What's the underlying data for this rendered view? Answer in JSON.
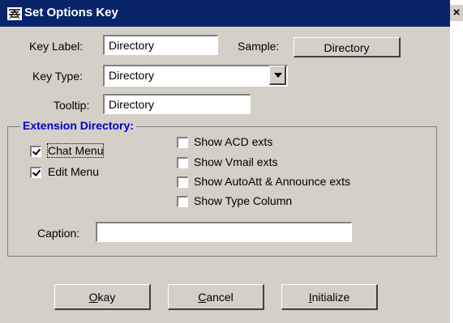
{
  "window": {
    "title": "Set Options Key",
    "close_glyph": "×"
  },
  "key_label": {
    "label": "Key Label:",
    "value": "Directory"
  },
  "sample": {
    "label": "Sample:",
    "button_text": "Directory"
  },
  "key_type": {
    "label": "Key Type:",
    "selected": "Directory"
  },
  "tooltip": {
    "label": "Tooltip:",
    "value": "Directory"
  },
  "extension_directory": {
    "title": "Extension Directory:",
    "chat_menu": {
      "label": "Chat Menu",
      "checked": true
    },
    "edit_menu": {
      "label": "Edit Menu",
      "checked": true
    },
    "show_acd": {
      "label": "Show ACD exts",
      "checked": false
    },
    "show_vmail": {
      "label": "Show Vmail exts",
      "checked": false
    },
    "show_autoatt": {
      "label": "Show AutoAtt & Announce exts",
      "checked": false
    },
    "show_type": {
      "label": "Show Type Column",
      "checked": false
    },
    "caption": {
      "label": "Caption:",
      "value": ""
    }
  },
  "buttons": {
    "okay": {
      "label": "Okay",
      "accel": "O",
      "rest": "kay"
    },
    "cancel": {
      "label": "Cancel",
      "accel": "C",
      "rest": "ancel"
    },
    "initialize": {
      "label": "Initialize",
      "accel": "I",
      "rest": "nitialize"
    }
  }
}
